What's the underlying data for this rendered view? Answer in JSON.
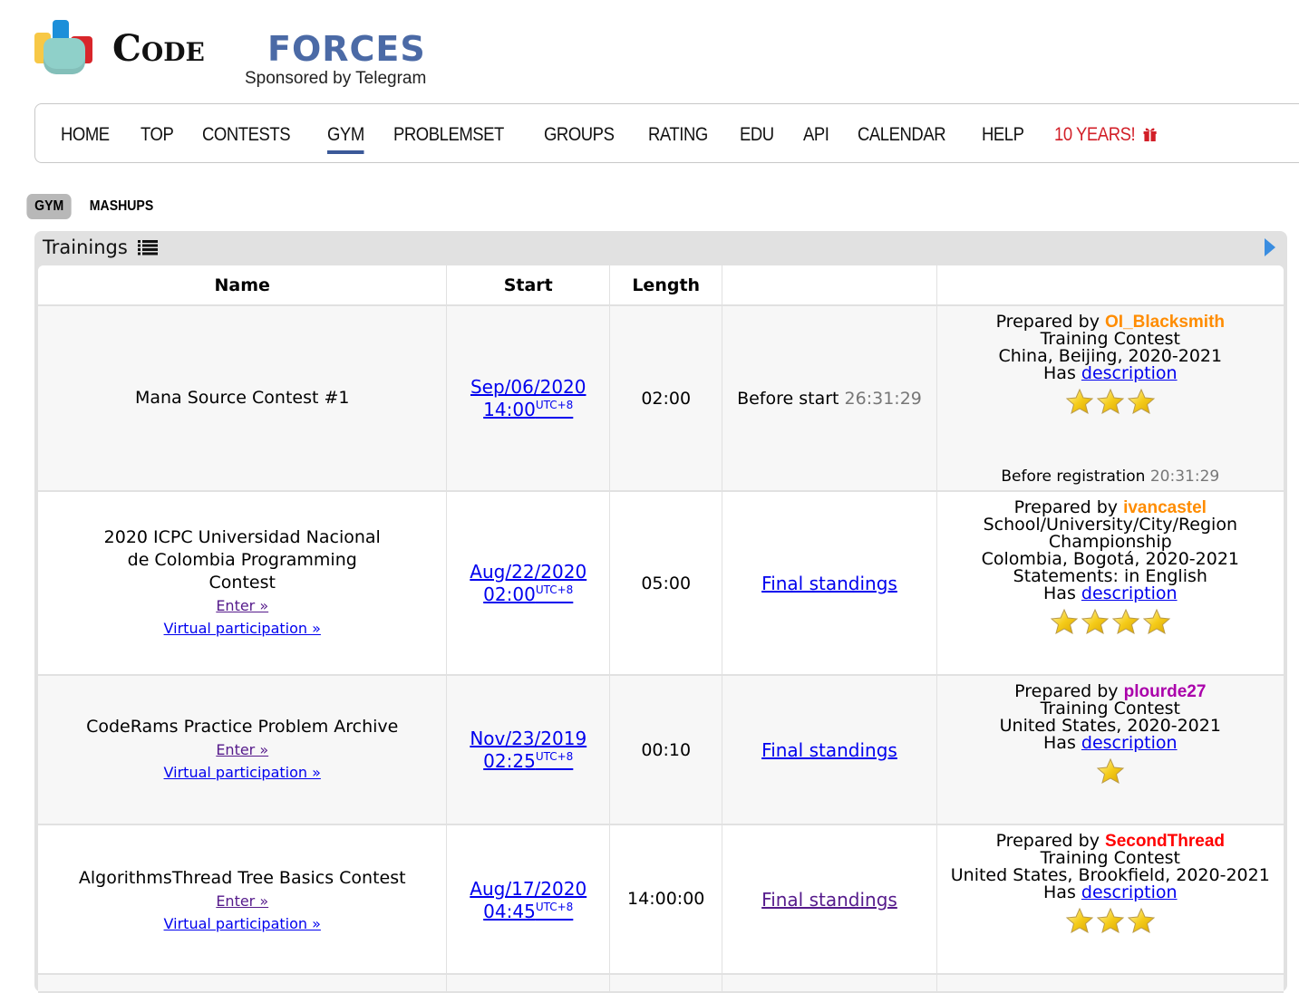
{
  "logo": {
    "code": "Code",
    "forces": "FORCES",
    "sponsor": "Sponsored by Telegram"
  },
  "menu": {
    "items": [
      {
        "label": "HOME"
      },
      {
        "label": "TOP"
      },
      {
        "label": "CONTESTS"
      },
      {
        "label": "GYM",
        "active": true
      },
      {
        "label": "PROBLEMSET"
      },
      {
        "label": "GROUPS"
      },
      {
        "label": "RATING"
      },
      {
        "label": "EDU"
      },
      {
        "label": "API"
      },
      {
        "label": "CALENDAR"
      },
      {
        "label": "HELP"
      },
      {
        "label": "10 YEARS!",
        "icon": "gift-icon",
        "color": "#d21f28"
      }
    ]
  },
  "subnav": {
    "tabs": [
      {
        "label": "GYM",
        "active": true
      },
      {
        "label": "MASHUPS"
      }
    ]
  },
  "trainings": {
    "title": "Trainings",
    "title_icon": "list-icon",
    "columns": [
      "Name",
      "Start",
      "Length",
      "",
      ""
    ],
    "rows": [
      {
        "name": "Mana Source Contest #1",
        "enter": null,
        "virtual": null,
        "start_date": "Sep/06/2020",
        "start_time": "14:00",
        "tz": "UTC+8",
        "length": "02:00",
        "status_label": "Before start",
        "status_countdown": "26:31:29",
        "prepared_by_label": "Prepared by",
        "author": "OI_Blacksmith",
        "author_color": "#ff8c00",
        "type": "Training Contest",
        "location": "China, Beijing, 2020-2021",
        "statements": null,
        "has_label": "Has",
        "description_link": "description",
        "stars": 3,
        "registration_label": "Before registration",
        "registration_countdown": "20:31:29"
      },
      {
        "name": "2020 ICPC Universidad Nacional de Colombia Programming Contest",
        "enter": "Enter »",
        "virtual": "Virtual participation »",
        "start_date": "Aug/22/2020",
        "start_time": "02:00",
        "tz": "UTC+8",
        "length": "05:00",
        "status_link": "Final standings",
        "prepared_by_label": "Prepared by",
        "author": "ivancastel",
        "author_color": "#ff8c00",
        "type": "School/University/City/Region Championship",
        "location": "Colombia, Bogotá, 2020-2021",
        "statements": "Statements: in English",
        "has_label": "Has",
        "description_link": "description",
        "stars": 4
      },
      {
        "name": "CodeRams Practice Problem Archive",
        "enter": "Enter »",
        "virtual": "Virtual participation »",
        "start_date": "Nov/23/2019",
        "start_time": "02:25",
        "tz": "UTC+8",
        "length": "00:10",
        "status_link": "Final standings",
        "prepared_by_label": "Prepared by",
        "author": "plourde27",
        "author_color": "#aa00aa",
        "type": "Training Contest",
        "location": "United States, 2020-2021",
        "statements": null,
        "has_label": "Has",
        "description_link": "description",
        "stars": 1
      },
      {
        "name": "AlgorithmsThread Tree Basics Contest",
        "enter": "Enter »",
        "virtual": "Virtual participation »",
        "start_date": "Aug/17/2020",
        "start_time": "04:45",
        "tz": "UTC+8",
        "length": "14:00:00",
        "status_link": "Final standings",
        "prepared_by_label": "Prepared by",
        "author": "SecondThread",
        "author_color": "#ff0000",
        "type": "Training Contest",
        "location": "United States, Brookfield, 2020-2021",
        "statements": null,
        "has_label": "Has",
        "description_link": "description",
        "stars": 3
      }
    ]
  }
}
